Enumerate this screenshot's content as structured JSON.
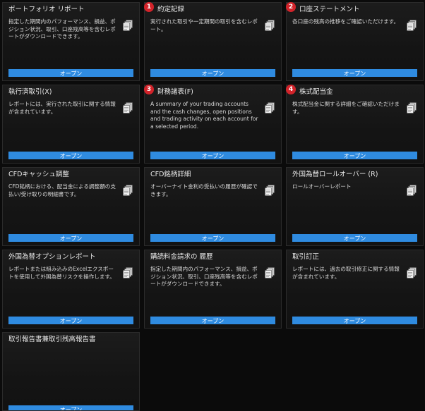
{
  "colors": {
    "accent": "#2f8be0",
    "badge": "#d2232a",
    "background": "#0b0b0b"
  },
  "button_label": "オープン",
  "cards": [
    {
      "title": "ポートフォリオ リポート",
      "badge": "",
      "desc": "指定した期間内のパフォーマンス、損益、ポジション状況、取引、口座残高等を含むレポートがダウンロードできます。",
      "icon": "documents-icon",
      "button": "オープン"
    },
    {
      "title": "約定記録",
      "badge": "1",
      "desc": "実行された取引や一定期間の取引を含むレポート。",
      "icon": "documents-icon",
      "button": "オープン"
    },
    {
      "title": "口座ステートメント",
      "badge": "2",
      "desc": "各口座の残高の推移をご確認いただけます。",
      "icon": "documents-icon",
      "button": "オープン"
    },
    {
      "title": "執行済取引(X)",
      "badge": "",
      "desc": "レポートには、実行された取引に関する情報が含まれています。",
      "icon": "documents-icon",
      "button": "オープン"
    },
    {
      "title": "財務諸表(F)",
      "badge": "3",
      "desc": "A summary of your trading accounts and the cash changes, open positions and trading activity on each account for a selected period.",
      "icon": "documents-icon",
      "button": "オープン"
    },
    {
      "title": "株式配当金",
      "badge": "4",
      "desc": "株式配当金に関する詳細をご確認いただけます。",
      "icon": "documents-icon",
      "button": "オープン"
    },
    {
      "title": "CFDキャッシュ調整",
      "badge": "",
      "desc": "CFD銘柄における、配当金による調整額の支払い/受け取りの明細書です。",
      "icon": "documents-icon",
      "button": "オープン"
    },
    {
      "title": "CFD銘柄詳細",
      "badge": "",
      "desc": "オーバーナイト金利の受払いの履歴が確認できます。",
      "icon": "documents-icon",
      "button": "オープン"
    },
    {
      "title": "外国為替ロールオーバー (R)",
      "badge": "",
      "desc": "ロールオーバーレポート",
      "icon": "documents-icon",
      "button": "オープン"
    },
    {
      "title": "外国為替オプションレポート",
      "badge": "",
      "desc": "レポートまたは組み込みのExcelエクスポートを使用して外国為替リスクを操作します。",
      "icon": "documents-icon",
      "button": "オープン"
    },
    {
      "title": "購読料金請求の 履歴",
      "badge": "",
      "desc": "指定した期間内のパフォーマンス、損益、ポジション状況、取引、口座残高等を含むレポートがダウンロードできます。",
      "icon": "documents-icon",
      "button": "オープン"
    },
    {
      "title": "取引訂正",
      "badge": "",
      "desc": "レポートには、過去の取引修正に関する情報が含まれています。",
      "icon": "documents-icon",
      "button": "オープン"
    },
    {
      "title": "取引報告書兼取引残高報告書",
      "badge": "",
      "desc": "",
      "icon": "",
      "button": "オープン"
    }
  ]
}
